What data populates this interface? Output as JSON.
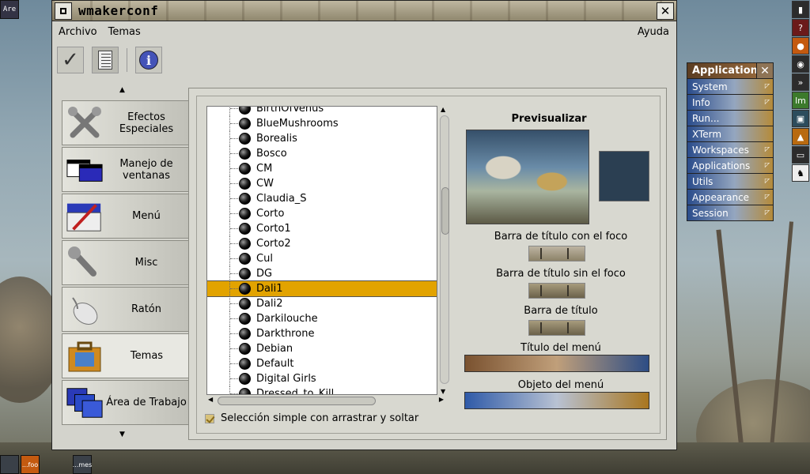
{
  "window": {
    "title": "wmakerconf",
    "close_glyph": "✕"
  },
  "menubar": {
    "archivo": "Archivo",
    "temas": "Temas",
    "ayuda": "Ayuda"
  },
  "toolbar": {
    "info_glyph": "i"
  },
  "sidebar": {
    "items": [
      {
        "label": "Efectos Especiales",
        "icon": "tools-icon"
      },
      {
        "label": "Manejo de ventanas",
        "icon": "windows-icon"
      },
      {
        "label": "Menú",
        "icon": "menu-edit-icon"
      },
      {
        "label": "Misc",
        "icon": "wrench-icon"
      },
      {
        "label": "Ratón",
        "icon": "mouse-icon"
      },
      {
        "label": "Temas",
        "icon": "briefcase-icon"
      },
      {
        "label": "Área de Trabajo",
        "icon": "workspace-icon"
      }
    ]
  },
  "themes": {
    "items": [
      "BirthOfVenus",
      "BlueMushrooms",
      "Borealis",
      "Bosco",
      "CM",
      "CW",
      "Claudia_S",
      "Corto",
      "Corto1",
      "Corto2",
      "Cul",
      "DG",
      "Dali1",
      "Dali2",
      "Darkilouche",
      "Darkthrone",
      "Debian",
      "Default",
      "Digital Girls",
      "Dressed_to_Kill"
    ],
    "selected": "Dali1"
  },
  "options": {
    "dnd_label": "Selección simple con arrastrar y soltar"
  },
  "preview": {
    "title": "Previsualizar",
    "focused_title": "Barra de título con el foco",
    "unfocused_title": "Barra de título sin el foco",
    "title_bar": "Barra de título",
    "menu_title": "Título del menú",
    "menu_item": "Objeto del menú",
    "swatch_color": "#2b3f52"
  },
  "appmenu": {
    "title": "Applications",
    "close_glyph": "✕",
    "items": [
      "System",
      "Info",
      "Run...",
      "XTerm",
      "Workspaces",
      "Applications",
      "Utils",
      "Appearance",
      "Session"
    ]
  },
  "dock": {
    "top_left_label": "Are",
    "bottom_icons": [
      "",
      "...foo",
      "...mes"
    ]
  }
}
